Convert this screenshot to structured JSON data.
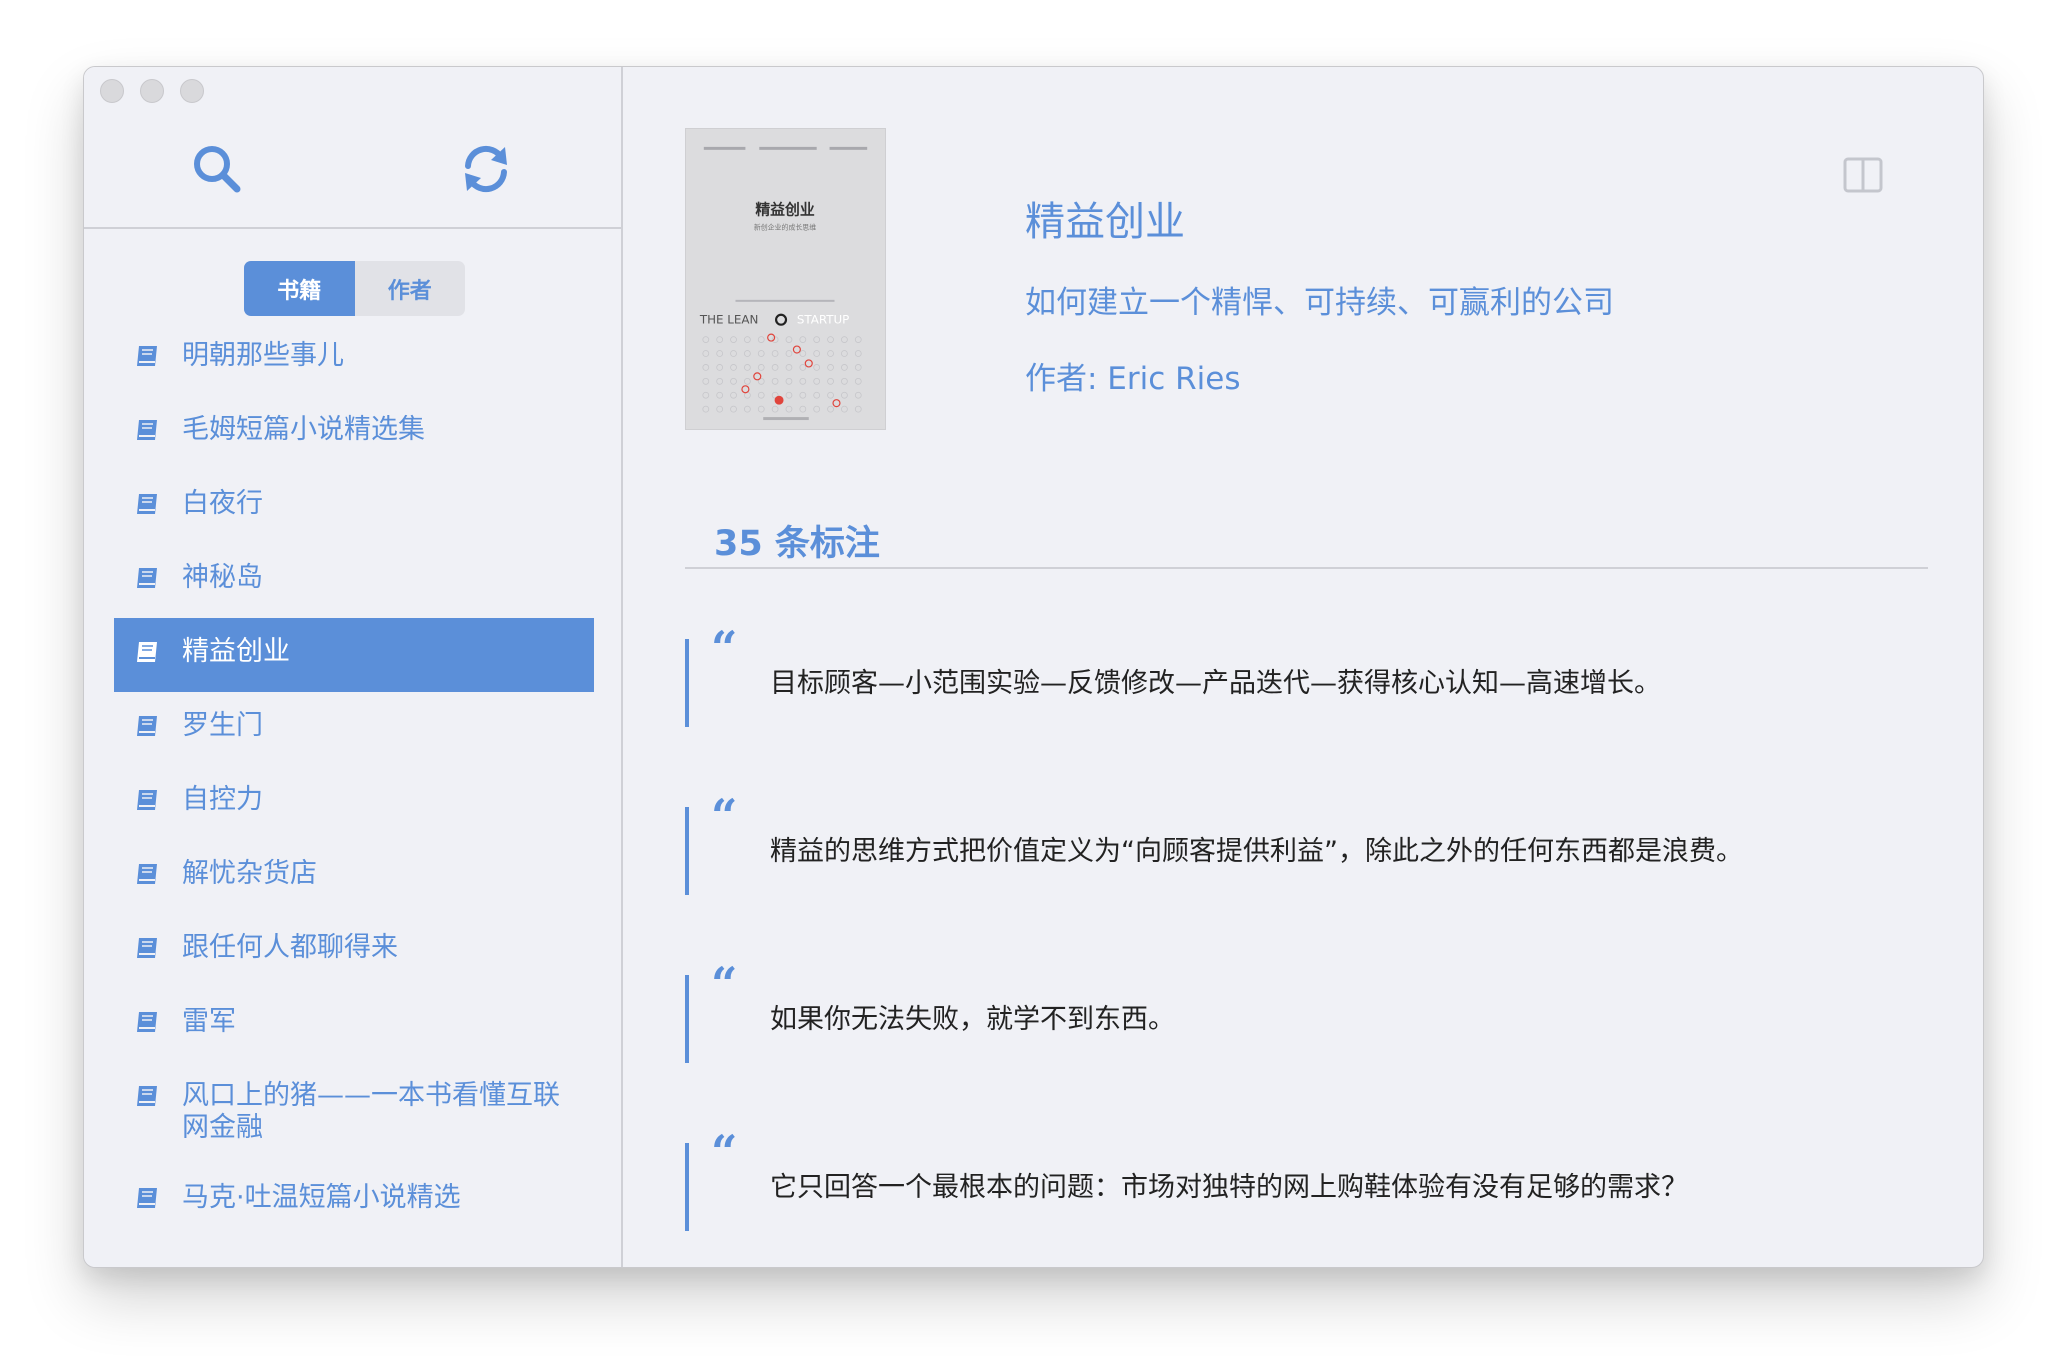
{
  "toolbar": {
    "search_icon": "search-icon",
    "refresh_icon": "refresh-icon"
  },
  "tabs": [
    {
      "label": "书籍",
      "active": true
    },
    {
      "label": "作者",
      "active": false
    }
  ],
  "books": [
    {
      "title": "明朝那些事儿",
      "selected": false
    },
    {
      "title": "毛姆短篇小说精选集",
      "selected": false
    },
    {
      "title": "白夜行",
      "selected": false
    },
    {
      "title": "神秘岛",
      "selected": false
    },
    {
      "title": "精益创业",
      "selected": true
    },
    {
      "title": "罗生门",
      "selected": false
    },
    {
      "title": "自控力",
      "selected": false
    },
    {
      "title": "解忧杂货店",
      "selected": false
    },
    {
      "title": "跟任何人都聊得来",
      "selected": false
    },
    {
      "title": "雷军",
      "selected": false
    },
    {
      "title": "风口上的猪——一本书看懂互联网金融",
      "selected": false
    },
    {
      "title": "马克·吐温短篇小说精选",
      "selected": false
    }
  ],
  "detail": {
    "title": "精益创业",
    "subtitle": "如何建立一个精悍、可持续、可赢利的公司",
    "author": "作者: Eric Ries",
    "cover": {
      "title": "精益创业",
      "subtitle": "新创企业的成长思维",
      "brand_left": "THE LEAN",
      "brand_right": "STARTUP"
    },
    "count_heading": "35 条标注"
  },
  "annotations": [
    {
      "quote_mark": "“",
      "text": "目标顾客—小范围实验—反馈修改—产品迭代—获得核心认知—高速增长。"
    },
    {
      "quote_mark": "“",
      "text": "精益的思维方式把价值定义为“向顾客提供利益”，除此之外的任何东西都是浪费。"
    },
    {
      "quote_mark": "“",
      "text": "如果你无法失败，就学不到东西。"
    },
    {
      "quote_mark": "“",
      "text": "它只回答一个最根本的问题：市场对独特的网上购鞋体验有没有足够的需求？"
    }
  ],
  "colors": {
    "accent": "#5b8fd9",
    "window_bg": "#f0f1f6",
    "text_dark": "#222222"
  }
}
